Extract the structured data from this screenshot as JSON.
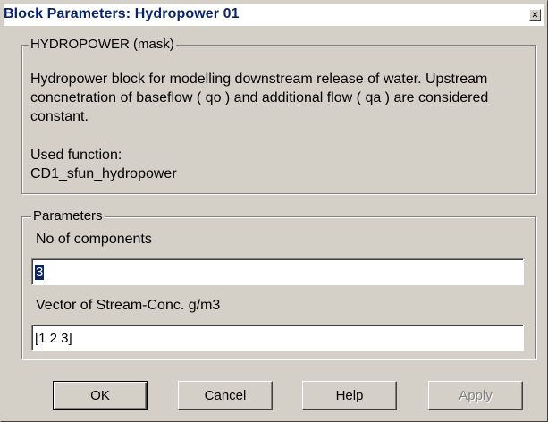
{
  "window": {
    "title": "Block Parameters: Hydropower 01",
    "close_glyph": "✕"
  },
  "mask_group": {
    "legend": "HYDROPOWER (mask)",
    "description": "Hydropower block for modelling downstream release of water. Upstream concnetration of baseflow ( qo ) and additional flow ( qa ) are considered constant.",
    "used_function_label": "Used function:",
    "used_function_value": "CD1_sfun_hydropower"
  },
  "parameters_group": {
    "legend": "Parameters",
    "fields": [
      {
        "label": "No of components",
        "value": "3"
      },
      {
        "label": "Vector of Stream-Conc. g/m3",
        "value": "[1 2 3]"
      }
    ]
  },
  "buttons": {
    "ok": "OK",
    "cancel": "Cancel",
    "help": "Help",
    "apply": "Apply"
  },
  "colors": {
    "face": "#d4d0c8",
    "title_text": "#0a246a",
    "selection": "#0a246a"
  }
}
